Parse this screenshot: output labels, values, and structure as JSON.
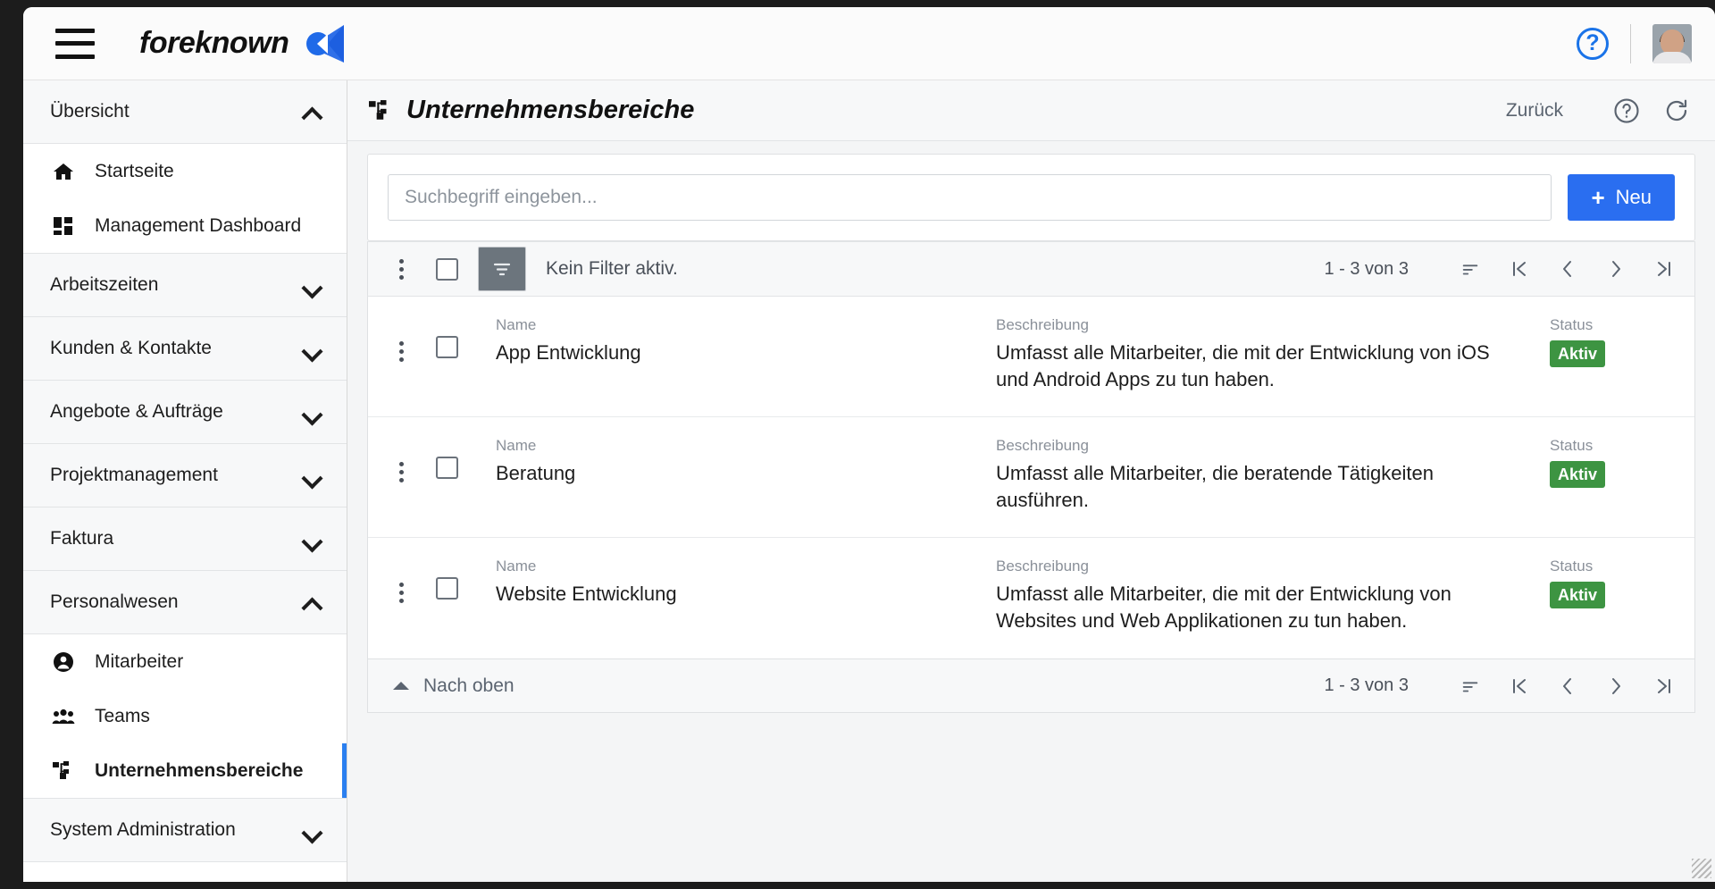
{
  "topbar": {
    "menu_icon": "hamburger-menu-icon",
    "brand_name": "foreknown",
    "brand_logo_icon": "foreknown-logo-icon",
    "help_icon": "help-circle-icon",
    "help_label": "?",
    "avatar_icon": "user-avatar"
  },
  "sidebar": {
    "groups": [
      {
        "label": "Übersicht",
        "expanded": true,
        "chevron": "chevron-up-icon",
        "items": [
          {
            "label": "Startseite",
            "icon": "home-icon",
            "active": false
          },
          {
            "label": "Management Dashboard",
            "icon": "dashboard-icon",
            "active": false
          }
        ]
      },
      {
        "label": "Arbeitszeiten",
        "expanded": false,
        "chevron": "chevron-down-icon",
        "items": []
      },
      {
        "label": "Kunden & Kontakte",
        "expanded": false,
        "chevron": "chevron-down-icon",
        "items": []
      },
      {
        "label": "Angebote & Aufträge",
        "expanded": false,
        "chevron": "chevron-down-icon",
        "items": []
      },
      {
        "label": "Projektmanagement",
        "expanded": false,
        "chevron": "chevron-down-icon",
        "items": []
      },
      {
        "label": "Faktura",
        "expanded": false,
        "chevron": "chevron-down-icon",
        "items": []
      },
      {
        "label": "Personalwesen",
        "expanded": true,
        "chevron": "chevron-up-icon",
        "items": [
          {
            "label": "Mitarbeiter",
            "icon": "person-icon",
            "active": false
          },
          {
            "label": "Teams",
            "icon": "people-group-icon",
            "active": false
          },
          {
            "label": "Unternehmensbereiche",
            "icon": "org-units-icon",
            "active": true
          }
        ]
      },
      {
        "label": "System Administration",
        "expanded": false,
        "chevron": "chevron-down-icon",
        "items": []
      }
    ]
  },
  "page": {
    "title": "Unternehmensbereiche",
    "title_icon": "org-units-icon",
    "back_label": "Zurück",
    "help_icon": "help-circle-icon",
    "refresh_icon": "refresh-icon"
  },
  "search": {
    "value": "",
    "placeholder": "Suchbegriff eingeben...",
    "new_button_label": "Neu",
    "new_button_icon": "plus-icon"
  },
  "toolbar": {
    "kebab_icon": "more-vertical-icon",
    "select_all_checkbox": false,
    "filter_icon": "filter-funnel-icon",
    "filter_status": "Kein Filter aktiv.",
    "pagination_label": "1 - 3 von 3",
    "sort_icon": "sort-icon",
    "first_page_icon": "first-page-icon",
    "prev_page_icon": "prev-page-icon",
    "next_page_icon": "next-page-icon",
    "last_page_icon": "last-page-icon"
  },
  "table": {
    "columns": {
      "name": "Name",
      "description": "Beschreibung",
      "status": "Status"
    },
    "rows": [
      {
        "name": "App Entwicklung",
        "description": "Umfasst alle Mitarbeiter, die mit der Entwicklung von iOS und Android Apps zu tun haben.",
        "status": "Aktiv",
        "status_color": "#3d9442",
        "checked": false
      },
      {
        "name": "Beratung",
        "description": "Umfasst alle Mitarbeiter, die beratende Tätigkeiten ausführen.",
        "status": "Aktiv",
        "status_color": "#3d9442",
        "checked": false
      },
      {
        "name": "Website Entwicklung",
        "description": "Umfasst alle Mitarbeiter, die mit der Entwicklung von Websites und Web Applikationen zu tun haben.",
        "status": "Aktiv",
        "status_color": "#3d9442",
        "checked": false
      }
    ]
  },
  "footer": {
    "scroll_top_label": "Nach oben",
    "scroll_top_icon": "caret-up-icon",
    "pagination_label": "1 - 3 von 3",
    "sort_icon": "sort-icon",
    "first_page_icon": "first-page-icon",
    "prev_page_icon": "prev-page-icon",
    "next_page_icon": "next-page-icon",
    "last_page_icon": "last-page-icon"
  },
  "colors": {
    "accent_blue": "#2a6ef0",
    "status_green": "#3d9442",
    "filter_gray": "#6c757d"
  }
}
